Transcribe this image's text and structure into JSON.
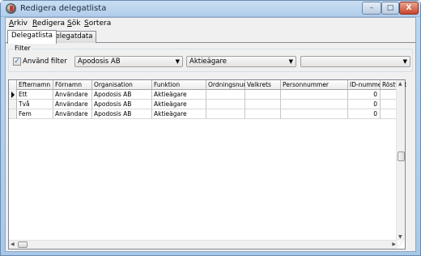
{
  "window": {
    "title": "Redigera delegatlista",
    "icon": "apodosis-app-icon",
    "controls": {
      "minimize": "–",
      "maximize": "□",
      "close": "X"
    }
  },
  "menu": {
    "items": [
      {
        "label": "Arkiv",
        "accel": "A",
        "rest": "rkiv"
      },
      {
        "label": "Redigera",
        "accel": "R",
        "rest": "edigera"
      },
      {
        "label": "Sök",
        "accel": "S",
        "rest": "ök"
      },
      {
        "label": "Sortera",
        "accel": "S",
        "rest": "ortera"
      }
    ]
  },
  "tabs": [
    {
      "label": "Delegatlista",
      "active": true
    },
    {
      "label": "Delegatdata",
      "active": false
    }
  ],
  "filter": {
    "group_label": "Filter",
    "checkbox_label": "Använd filter",
    "checkbox_checked": true,
    "combo1_value": "Apodosis AB",
    "combo2_value": "Aktieägare",
    "combo3_value": ""
  },
  "grid": {
    "columns": [
      "Efternamn",
      "Förnamn",
      "Organisation",
      "Funktion",
      "Ordningsnummer",
      "Valkrets",
      "Personnummer",
      "ID-nummer",
      "Röstvikt"
    ],
    "rows": [
      [
        "Ett",
        "Användare",
        "Apodosis AB",
        "Aktieägare",
        "",
        "",
        "",
        "0",
        ""
      ],
      [
        "Två",
        "Användare",
        "Apodosis AB",
        "Aktieägare",
        "",
        "",
        "",
        "0",
        ""
      ],
      [
        "Fem",
        "Användare",
        "Apodosis AB",
        "Aktieägare",
        "",
        "",
        "",
        "0",
        ""
      ]
    ],
    "current_row": 0
  }
}
